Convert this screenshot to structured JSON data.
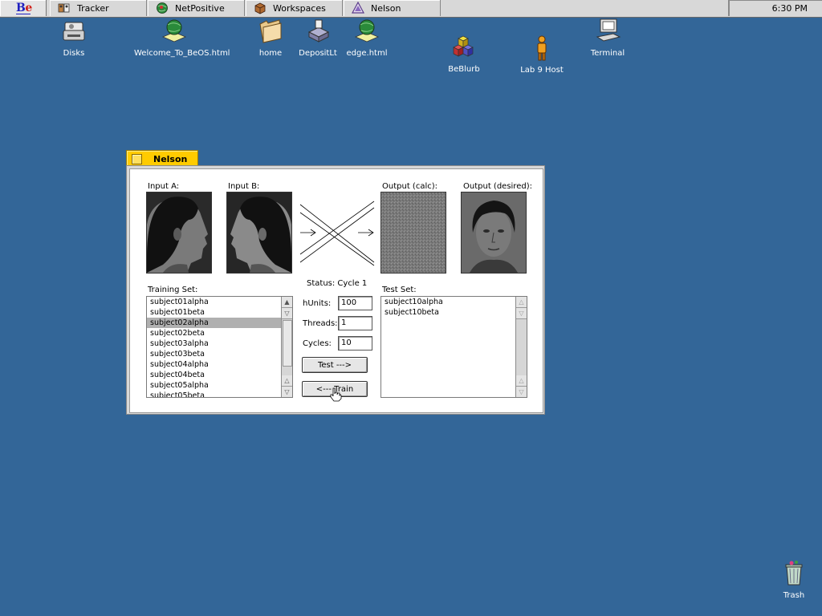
{
  "deskbar": {
    "tasks": [
      {
        "label": "Tracker",
        "icon": "tracker-icon"
      },
      {
        "label": "NetPositive",
        "icon": "netpositive-icon"
      },
      {
        "label": "Workspaces",
        "icon": "workspaces-icon"
      },
      {
        "label": "Nelson",
        "icon": "nelson-icon"
      }
    ],
    "clock": "6:30 PM"
  },
  "desktop": {
    "icons": [
      {
        "label": "Disks"
      },
      {
        "label": "Welcome_To_BeOS.html"
      },
      {
        "label": "home"
      },
      {
        "label": "DepositLt"
      },
      {
        "label": "edge.html"
      },
      {
        "label": "BeBlurb"
      },
      {
        "label": "Lab 9 Host"
      },
      {
        "label": "Terminal"
      },
      {
        "label": "Trash"
      }
    ]
  },
  "window": {
    "title": "Nelson",
    "input_a_label": "Input A:",
    "input_b_label": "Input B:",
    "output_calc_label": "Output (calc):",
    "output_desired_label": "Output (desired):",
    "status": "Status: Cycle 1",
    "training_set_label": "Training Set:",
    "training_set": [
      "subject01alpha",
      "subject01beta",
      "subject02alpha",
      "subject02beta",
      "subject03alpha",
      "subject03beta",
      "subject04alpha",
      "subject04beta",
      "subject05alpha",
      "subject05beta"
    ],
    "training_selected_index": 2,
    "test_set_label": "Test Set:",
    "test_set": [
      "subject10alpha",
      "subject10beta"
    ],
    "hunits_label": "hUnits:",
    "hunits_value": "100",
    "threads_label": "Threads:",
    "threads_value": "1",
    "cycles_label": "Cycles:",
    "cycles_value": "10",
    "test_button": "Test --->",
    "train_button": "<--- Train"
  },
  "colors": {
    "desktop": "#336698",
    "window_tab": "#ffcb00"
  }
}
